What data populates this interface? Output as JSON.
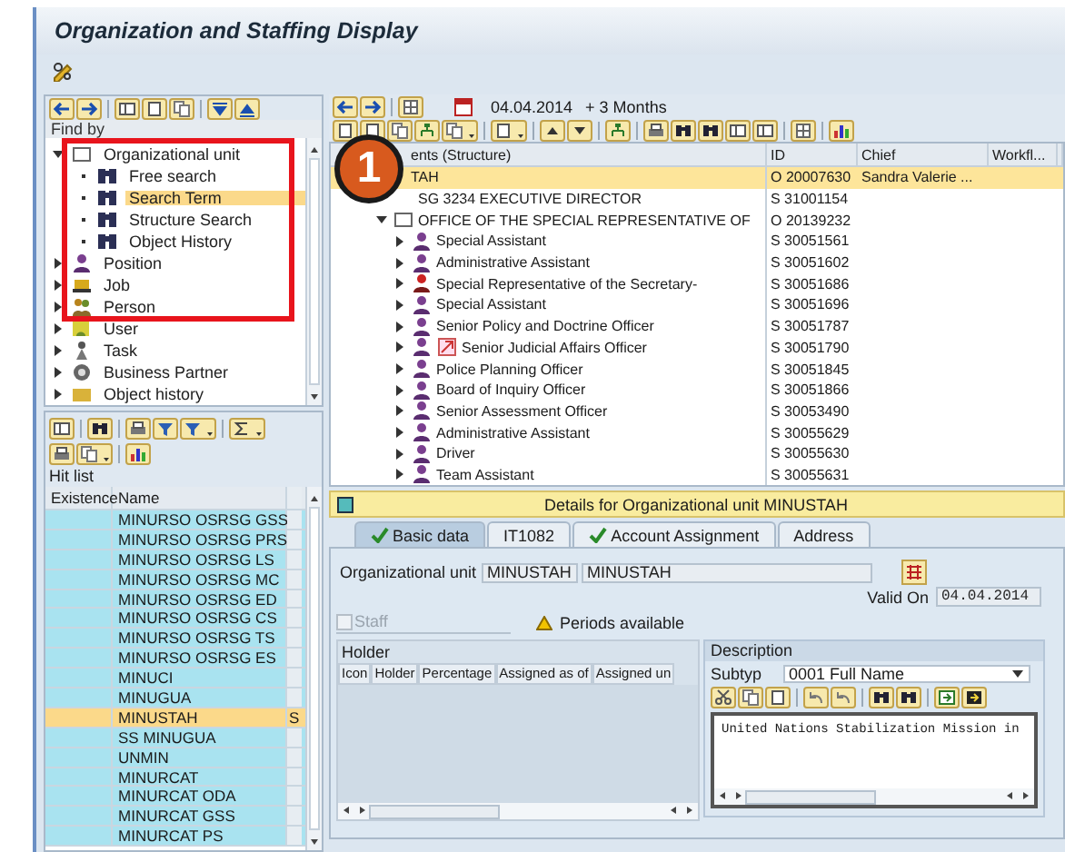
{
  "window": {
    "title": "Organization and Staffing Display"
  },
  "annotation": {
    "number": "1"
  },
  "find_panel": {
    "header": "Find by",
    "tree": [
      {
        "label": "Organizational unit",
        "kind": "org-unit",
        "expanded": true,
        "selected": false,
        "children": [
          {
            "label": "Free search",
            "kind": "search",
            "selected": false
          },
          {
            "label": "Search Term",
            "kind": "search",
            "selected": true
          },
          {
            "label": "Structure Search",
            "kind": "search",
            "selected": false
          },
          {
            "label": "Object History",
            "kind": "search",
            "selected": false
          }
        ]
      },
      {
        "label": "Position",
        "kind": "position",
        "expanded": false,
        "selected": false
      },
      {
        "label": "Job",
        "kind": "job",
        "expanded": false,
        "selected": false
      },
      {
        "label": "Person",
        "kind": "person",
        "expanded": false,
        "selected": false
      },
      {
        "label": "User",
        "kind": "user",
        "expanded": false,
        "selected": false
      },
      {
        "label": "Task",
        "kind": "task",
        "expanded": false,
        "selected": false
      },
      {
        "label": "Business Partner",
        "kind": "partner",
        "expanded": false,
        "selected": false
      },
      {
        "label": "Object history",
        "kind": "history",
        "expanded": false,
        "selected": false
      }
    ]
  },
  "hit_list": {
    "title": "Hit list",
    "columns": [
      "Existence",
      "Name"
    ],
    "rows": [
      {
        "name": "MINURSO OSRSG GSS",
        "selected": false
      },
      {
        "name": "MINURSO OSRSG PRS",
        "selected": false
      },
      {
        "name": "MINURSO OSRSG LS",
        "selected": false
      },
      {
        "name": "MINURSO OSRSG MC",
        "selected": false
      },
      {
        "name": "MINURSO OSRSG ED",
        "selected": false
      },
      {
        "name": "MINURSO OSRSG CS",
        "selected": false
      },
      {
        "name": "MINURSO OSRSG TS",
        "selected": false
      },
      {
        "name": "MINURSO OSRSG ES",
        "selected": false
      },
      {
        "name": "MINUCI",
        "selected": false
      },
      {
        "name": "MINUGUA",
        "selected": false
      },
      {
        "name": "MINUSTAH",
        "column_3": "S",
        "selected": true
      },
      {
        "name": "SS MINUGUA",
        "selected": false
      },
      {
        "name": "UNMIN",
        "selected": false
      },
      {
        "name": "MINURCAT",
        "selected": false
      },
      {
        "name": "MINURCAT ODA",
        "selected": false
      },
      {
        "name": "MINURCAT GSS",
        "selected": false
      },
      {
        "name": "MINURCAT PS",
        "selected": false
      }
    ]
  },
  "structure": {
    "date": "04.04.2014",
    "period": "+ 3 Months",
    "columns": [
      "ents (Structure)",
      "ID",
      "Chief",
      "Workfl..."
    ],
    "rows": [
      {
        "name": "TAH",
        "id": "O 20007630",
        "chief": "Sandra Valerie ...",
        "selected": true,
        "children": [
          {
            "name": "SG 3234 EXECUTIVE DIRECTOR",
            "id": "S 31001154",
            "selected": false
          },
          {
            "name": "OFFICE OF THE SPECIAL REPRESENTATIVE OF",
            "id": "O 20139232",
            "kind": "org",
            "expanded": true,
            "selected": false,
            "children": [
              {
                "name": "Special Assistant",
                "id": "S 30051561",
                "kind": "position",
                "expanded": false,
                "selected": false
              },
              {
                "name": "Administrative Assistant",
                "id": "S 30051602",
                "kind": "position",
                "expanded": false,
                "selected": false
              },
              {
                "name": "Special Representative of the Secretary-",
                "id": "S 30051686",
                "kind": "head-position",
                "expanded": false,
                "selected": false
              },
              {
                "name": "Special Assistant",
                "id": "S 30051696",
                "kind": "position",
                "expanded": false,
                "selected": false
              },
              {
                "name": "Senior Policy and Doctrine Officer",
                "id": "S 30051787",
                "kind": "position",
                "expanded": false,
                "selected": false
              },
              {
                "name": "Senior Judicial Affairs Officer",
                "id": "S 30051790",
                "kind": "position-linked",
                "expanded": false,
                "selected": false
              },
              {
                "name": "Police Planning Officer",
                "id": "S 30051845",
                "kind": "position",
                "expanded": false,
                "selected": false
              },
              {
                "name": "Board of Inquiry Officer",
                "id": "S 30051866",
                "kind": "position",
                "expanded": false,
                "selected": false
              },
              {
                "name": "Senior Assessment Officer",
                "id": "S 30053490",
                "kind": "position",
                "expanded": false,
                "selected": false
              },
              {
                "name": "Administrative Assistant",
                "id": "S 30055629",
                "kind": "position",
                "expanded": false,
                "selected": false
              },
              {
                "name": "Driver",
                "id": "S 30055630",
                "kind": "position",
                "expanded": false,
                "selected": false
              },
              {
                "name": "Team Assistant",
                "id": "S 30055631",
                "kind": "position",
                "expanded": false,
                "selected": false
              }
            ]
          }
        ]
      }
    ]
  },
  "details": {
    "title": "Details for Organizational unit MINUSTAH",
    "tabs": [
      {
        "label": "Basic data",
        "selected": true,
        "has_data": true
      },
      {
        "label": "IT1082",
        "selected": false,
        "has_data": false
      },
      {
        "label": "Account Assignment",
        "selected": false,
        "has_data": true
      },
      {
        "label": "Address",
        "selected": false,
        "has_data": false
      }
    ],
    "org_unit": {
      "label": "Organizational unit",
      "short": "MINUSTAH",
      "long": "MINUSTAH"
    },
    "valid_on": {
      "label": "Valid On",
      "value": "04.04.2014"
    },
    "staff": {
      "label": "Staff",
      "checked": false,
      "disabled": true
    },
    "periods": "Periods available",
    "holder": {
      "title": "Holder",
      "columns": [
        "Icon",
        "Holder",
        "Percentage",
        "Assigned as of",
        "Assigned un"
      ]
    },
    "description": {
      "title": "Description",
      "subtype_label": "Subtyp",
      "subtype": "0001 Full Name",
      "text": "United Nations Stabilization Mission in"
    }
  }
}
